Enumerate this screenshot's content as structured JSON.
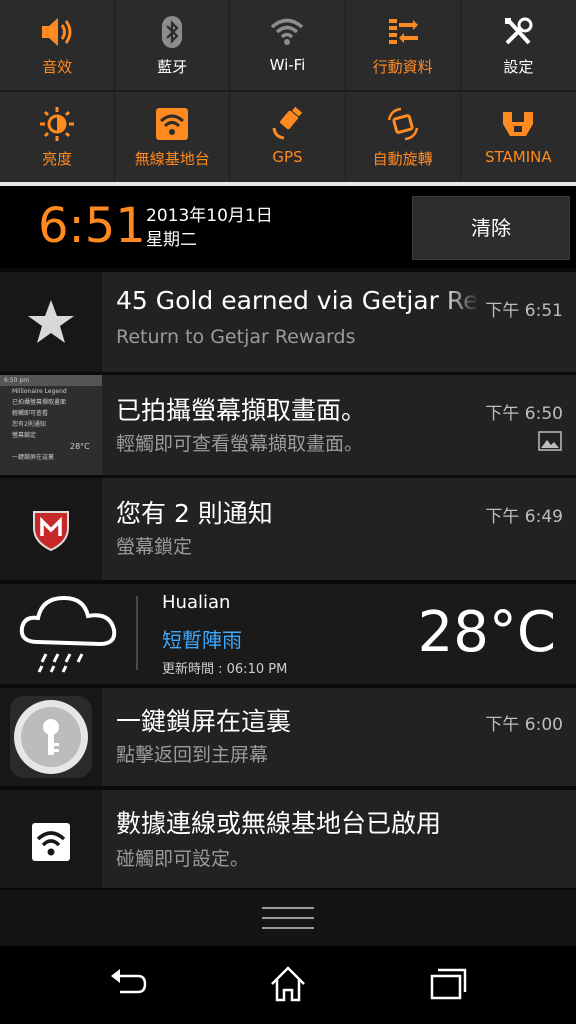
{
  "quick_settings": [
    {
      "label": "音效",
      "icon": "volume-icon",
      "state": "on"
    },
    {
      "label": "藍牙",
      "icon": "bluetooth-icon",
      "state": "off"
    },
    {
      "label": "Wi-Fi",
      "icon": "wifi-icon",
      "state": "off"
    },
    {
      "label": "行動資料",
      "icon": "mobile-data-icon",
      "state": "on"
    },
    {
      "label": "設定",
      "icon": "settings-tools-icon",
      "state": "off"
    },
    {
      "label": "亮度",
      "icon": "brightness-icon",
      "state": "on"
    },
    {
      "label": "無線基地台",
      "icon": "hotspot-icon",
      "state": "on"
    },
    {
      "label": "GPS",
      "icon": "gps-icon",
      "state": "on"
    },
    {
      "label": "自動旋轉",
      "icon": "auto-rotate-icon",
      "state": "on"
    },
    {
      "label": "STAMINA",
      "icon": "stamina-icon",
      "state": "on"
    }
  ],
  "header": {
    "time": "6:51",
    "date": "2013年10月1日",
    "weekday": "星期二",
    "clear_label": "清除"
  },
  "notifications": [
    {
      "title": "45 Gold earned via Getjar Re",
      "subtitle": "Return to Getjar Rewards",
      "time": "下午 6:51",
      "icon": "star-icon"
    },
    {
      "title": "已拍攝螢幕擷取畫面。",
      "subtitle": "輕觸即可查看螢幕擷取畫面。",
      "time": "下午 6:50",
      "icon": "screenshot-thumbnail"
    },
    {
      "title": "您有 2 則通知",
      "subtitle": "螢幕鎖定",
      "time": "下午 6:49",
      "icon": "mcafee-icon"
    },
    {
      "title": "一鍵鎖屏在這裏",
      "subtitle": "點擊返回到主屏幕",
      "time": "下午 6:00",
      "icon": "key-lock-icon"
    },
    {
      "title": "數據連線或無線基地台已啟用",
      "subtitle": "碰觸即可設定。",
      "time": "",
      "icon": "hotspot-icon"
    }
  ],
  "weather": {
    "city": "Hualian",
    "condition": "短暫陣雨",
    "updated": "更新時間 : 06:10 PM",
    "temperature": "28°C"
  },
  "thumbnail": {
    "lines": [
      "6:50 pm",
      "Millionaire Legend",
      "已拍攝螢幕擷取畫面",
      "輕觸即可查看",
      "您有2則通知",
      "螢幕鎖定",
      "28°C",
      "一鍵鎖屏在這裏"
    ]
  },
  "colors": {
    "accent": "#ff8a1f",
    "weather_blue": "#3ea8ff"
  }
}
